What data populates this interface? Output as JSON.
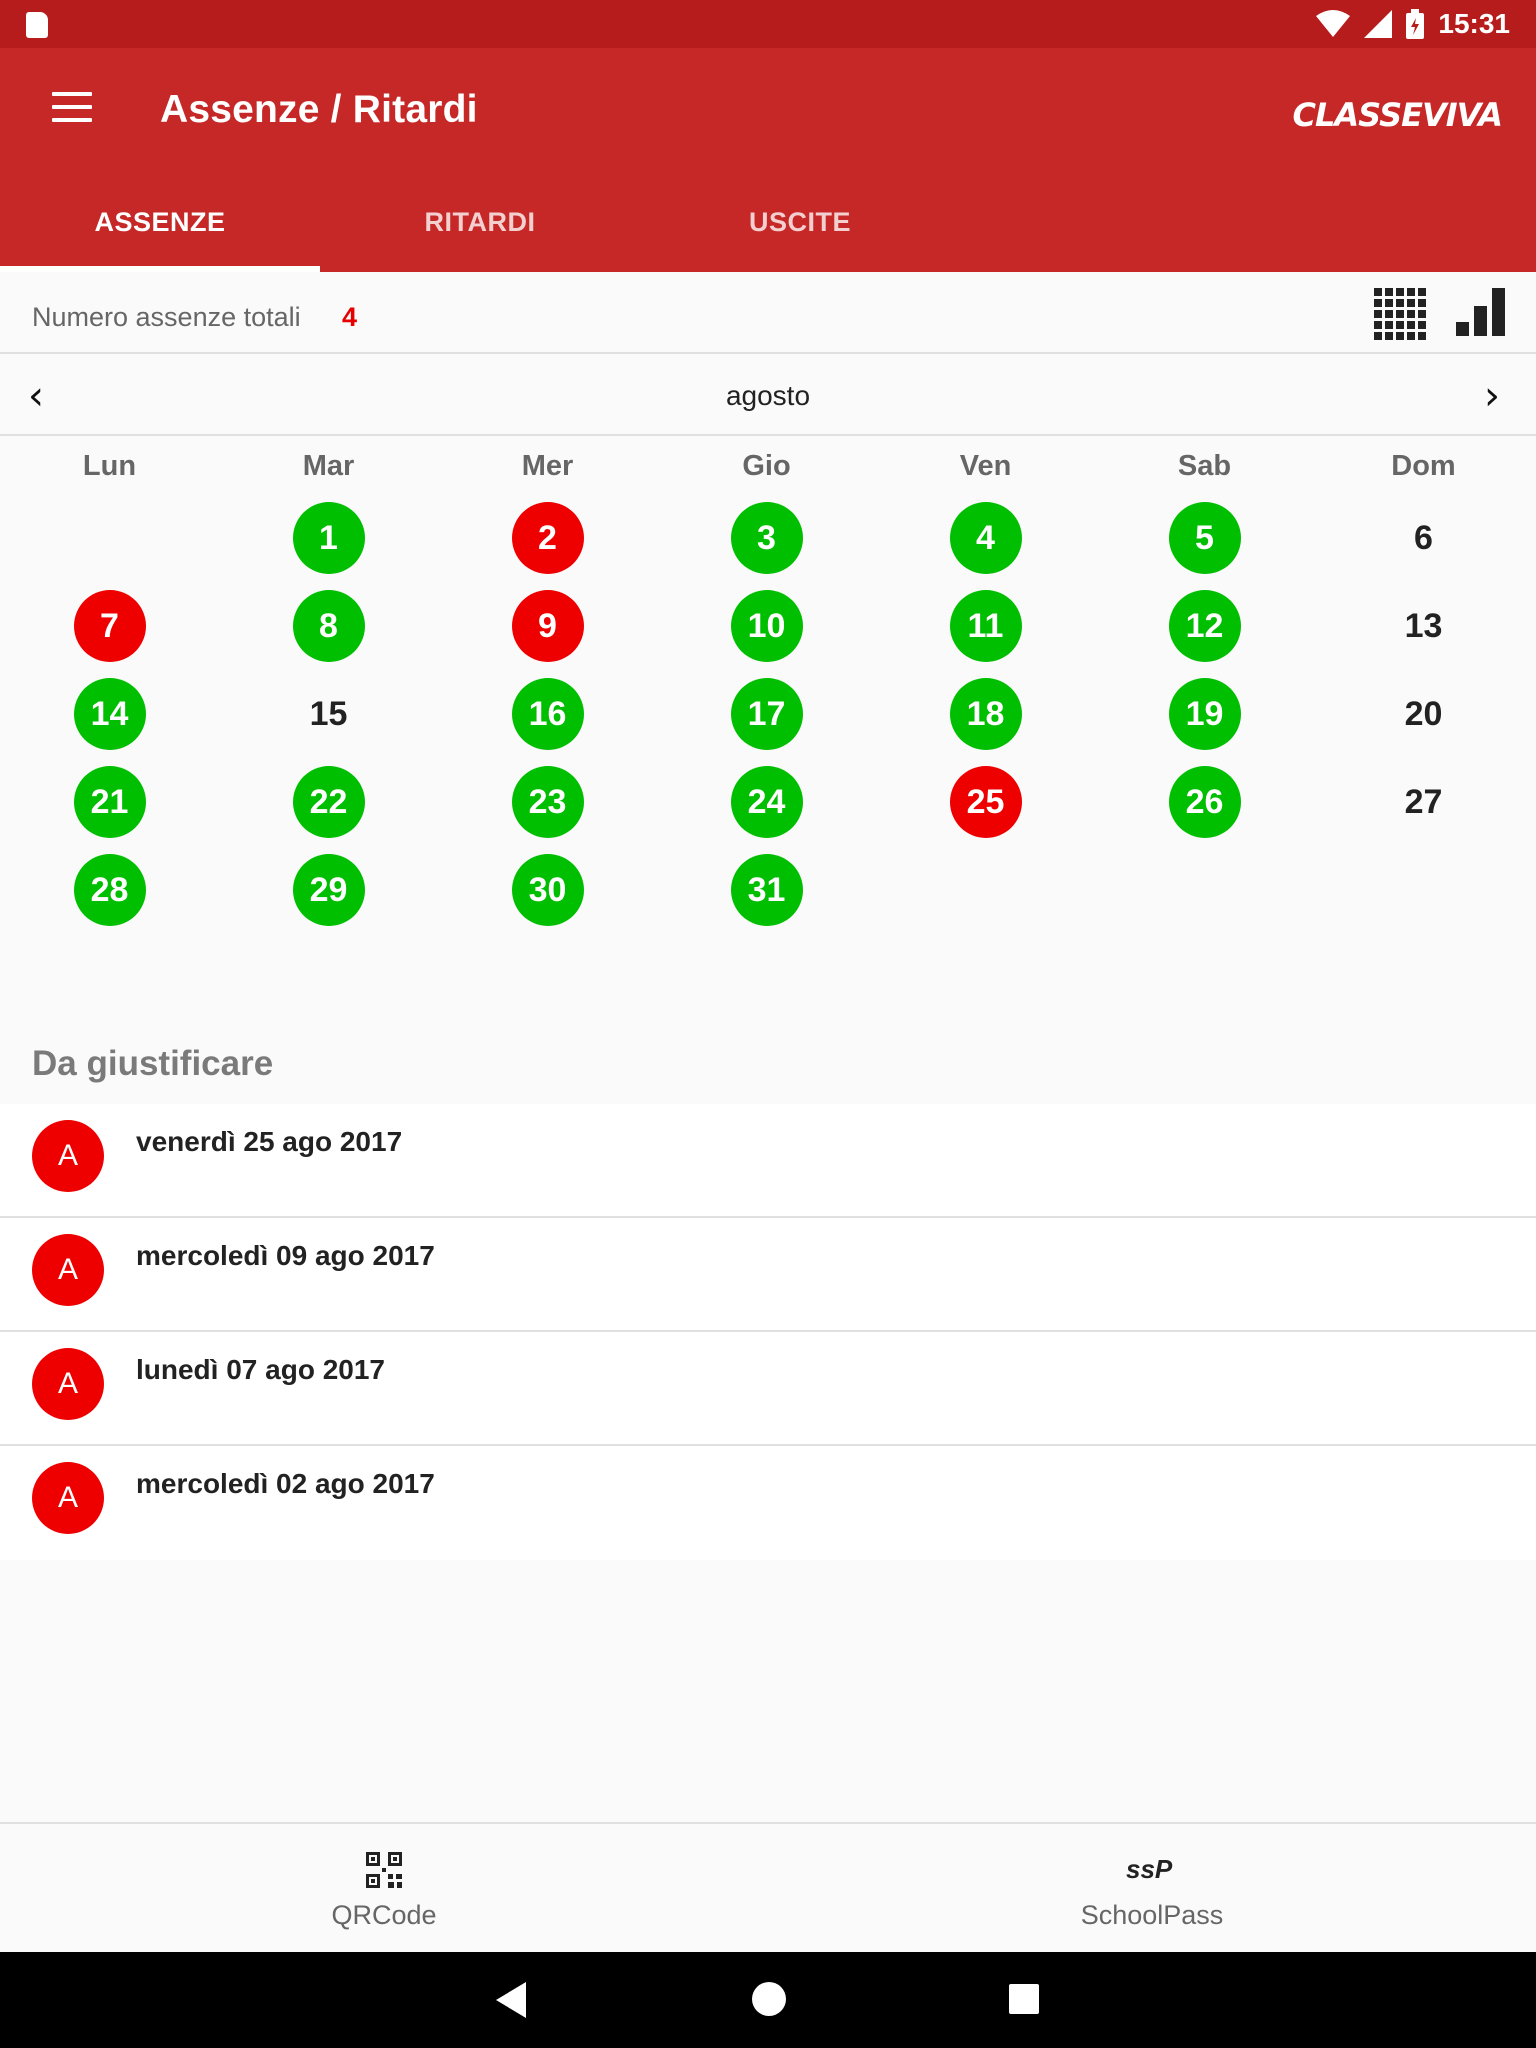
{
  "statusbar": {
    "time": "15:31"
  },
  "toolbar": {
    "title": "Assenze / Ritardi",
    "logo": "CLASSEVIVA"
  },
  "tabs": [
    {
      "label": "ASSENZE",
      "active": true
    },
    {
      "label": "RITARDI",
      "active": false
    },
    {
      "label": "USCITE",
      "active": false
    }
  ],
  "totals": {
    "label": "Numero assenze totali",
    "count": "4"
  },
  "calendar": {
    "month": "agosto",
    "weekdays": [
      "Lun",
      "Mar",
      "Mer",
      "Gio",
      "Ven",
      "Sab",
      "Dom"
    ],
    "days": [
      {
        "n": "1",
        "s": "green"
      },
      {
        "n": "2",
        "s": "red"
      },
      {
        "n": "3",
        "s": "green"
      },
      {
        "n": "4",
        "s": "green"
      },
      {
        "n": "5",
        "s": "green"
      },
      {
        "n": "6",
        "s": "plain"
      },
      {
        "n": "7",
        "s": "red"
      },
      {
        "n": "8",
        "s": "green"
      },
      {
        "n": "9",
        "s": "red"
      },
      {
        "n": "10",
        "s": "green"
      },
      {
        "n": "11",
        "s": "green"
      },
      {
        "n": "12",
        "s": "green"
      },
      {
        "n": "13",
        "s": "plain"
      },
      {
        "n": "14",
        "s": "green"
      },
      {
        "n": "15",
        "s": "plain"
      },
      {
        "n": "16",
        "s": "green"
      },
      {
        "n": "17",
        "s": "green"
      },
      {
        "n": "18",
        "s": "green"
      },
      {
        "n": "19",
        "s": "green"
      },
      {
        "n": "20",
        "s": "plain"
      },
      {
        "n": "21",
        "s": "green"
      },
      {
        "n": "22",
        "s": "green"
      },
      {
        "n": "23",
        "s": "green"
      },
      {
        "n": "24",
        "s": "green"
      },
      {
        "n": "25",
        "s": "red"
      },
      {
        "n": "26",
        "s": "green"
      },
      {
        "n": "27",
        "s": "plain"
      },
      {
        "n": "28",
        "s": "green"
      },
      {
        "n": "29",
        "s": "green"
      },
      {
        "n": "30",
        "s": "green"
      },
      {
        "n": "31",
        "s": "green"
      }
    ]
  },
  "section": {
    "title": "Da giustificare",
    "items": [
      {
        "badge": "A",
        "date": "venerdì 25 ago 2017"
      },
      {
        "badge": "A",
        "date": "mercoledì 09 ago 2017"
      },
      {
        "badge": "A",
        "date": "lunedì 07 ago 2017"
      },
      {
        "badge": "A",
        "date": "mercoledì 02 ago 2017"
      }
    ]
  },
  "bottomnav": [
    {
      "label": "QRCode",
      "icon": "qr-code-icon"
    },
    {
      "label": "SchoolPass",
      "icon": "schoolpass-icon",
      "logo_text": "ssP"
    }
  ],
  "colors": {
    "primary": "#c62828",
    "statusbar": "#b71c1c",
    "present": "#00bf00",
    "absent": "#ee0000"
  }
}
